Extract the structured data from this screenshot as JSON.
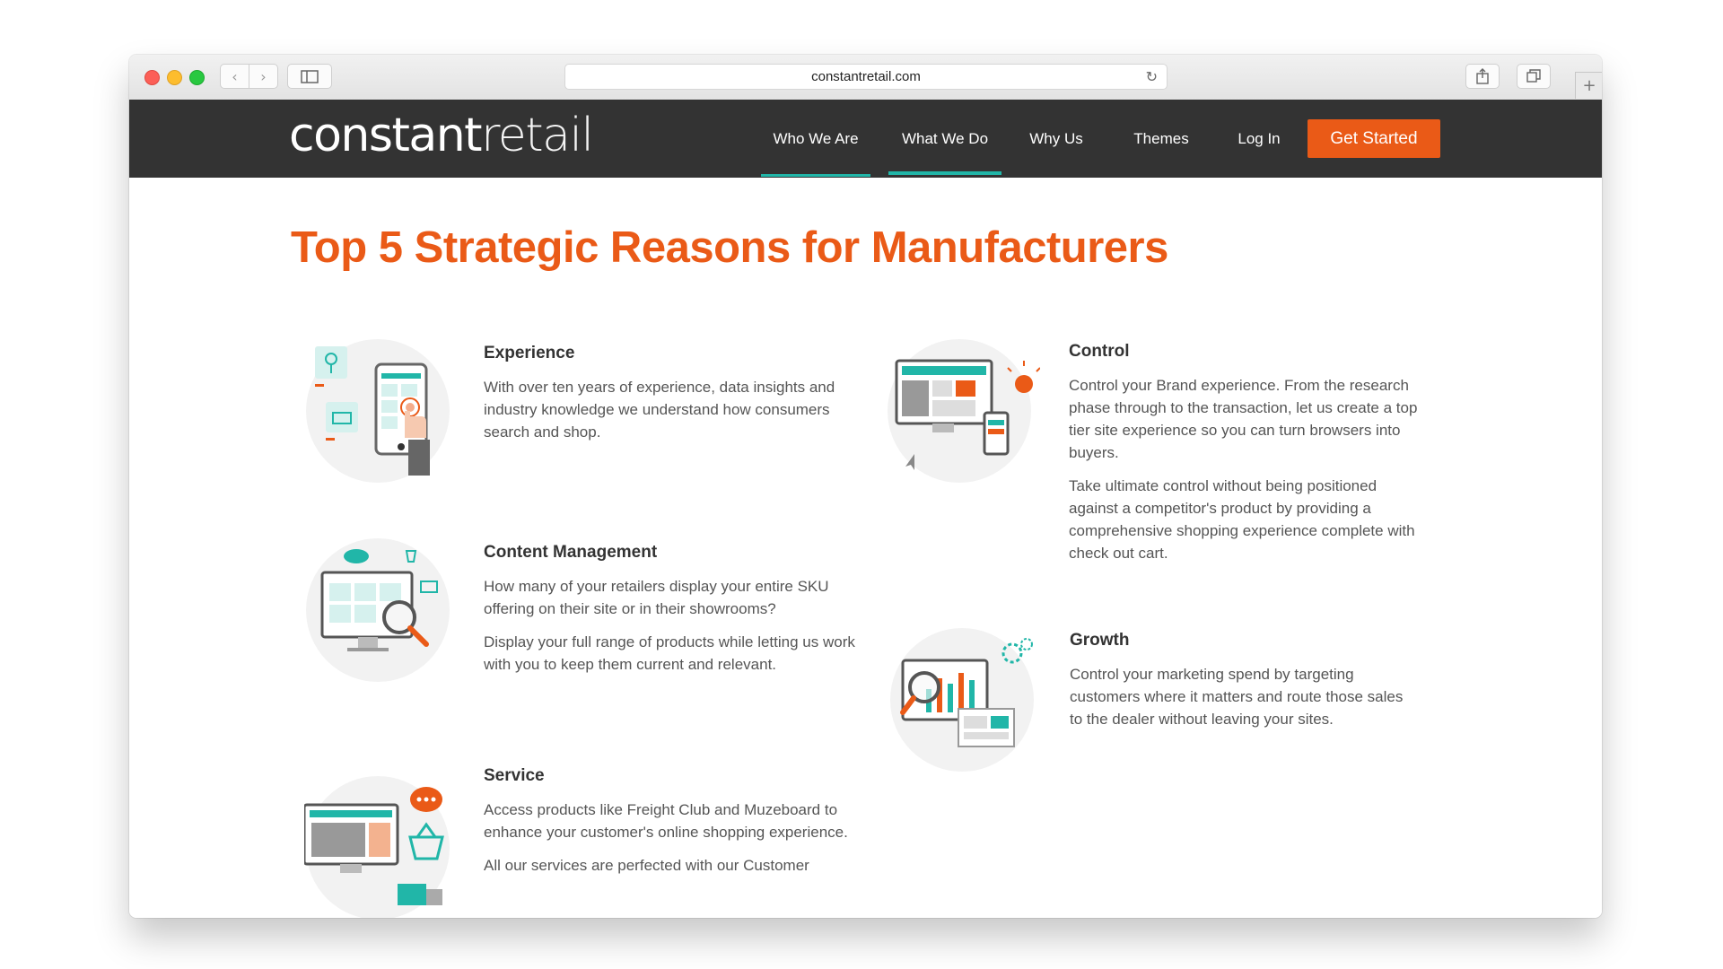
{
  "browser": {
    "url": "constantretail.com",
    "icons": [
      "back-arrow-icon",
      "forward-arrow-icon",
      "sidebar-icon",
      "reload-icon",
      "share-icon",
      "tabs-icon",
      "plus-icon"
    ]
  },
  "site": {
    "logo_bold": "constant",
    "logo_light": "retail",
    "nav": [
      "Who We Are",
      "What We Do",
      "Why Us",
      "Themes",
      "Log In"
    ],
    "cta": "Get Started",
    "colors": {
      "accent": "#ea5a17",
      "teal": "#21b6a8",
      "header_bg": "#333333"
    }
  },
  "page": {
    "title": "Top 5 Strategic Reasons for Manufacturers",
    "features": {
      "experience": {
        "title": "Experience",
        "p1": "With over ten years of experience, data insights and industry knowledge we understand how consumers search and shop."
      },
      "content": {
        "title": "Content Management",
        "p1": "How many of your retailers display your entire SKU offering on their site or in their showrooms?",
        "p2": "Display your full range of products while letting us work with you to keep them current and relevant."
      },
      "service": {
        "title": "Service",
        "p1": "Access products like Freight Club and Muzeboard to enhance your customer's online shopping experience.",
        "p2": "All our services are perfected with our Customer"
      },
      "control": {
        "title": "Control",
        "p1": "Control your Brand experience. From the research phase through to the transaction, let us create a top tier site experience so you can turn browsers into buyers.",
        "p2": "Take ultimate control without being positioned against a competitor's product by providing a comprehensive shopping experience complete with check out cart."
      },
      "growth": {
        "title": "Growth",
        "p1": "Control your marketing spend by targeting customers where it matters and route those sales to the dealer without leaving your sites."
      }
    }
  }
}
